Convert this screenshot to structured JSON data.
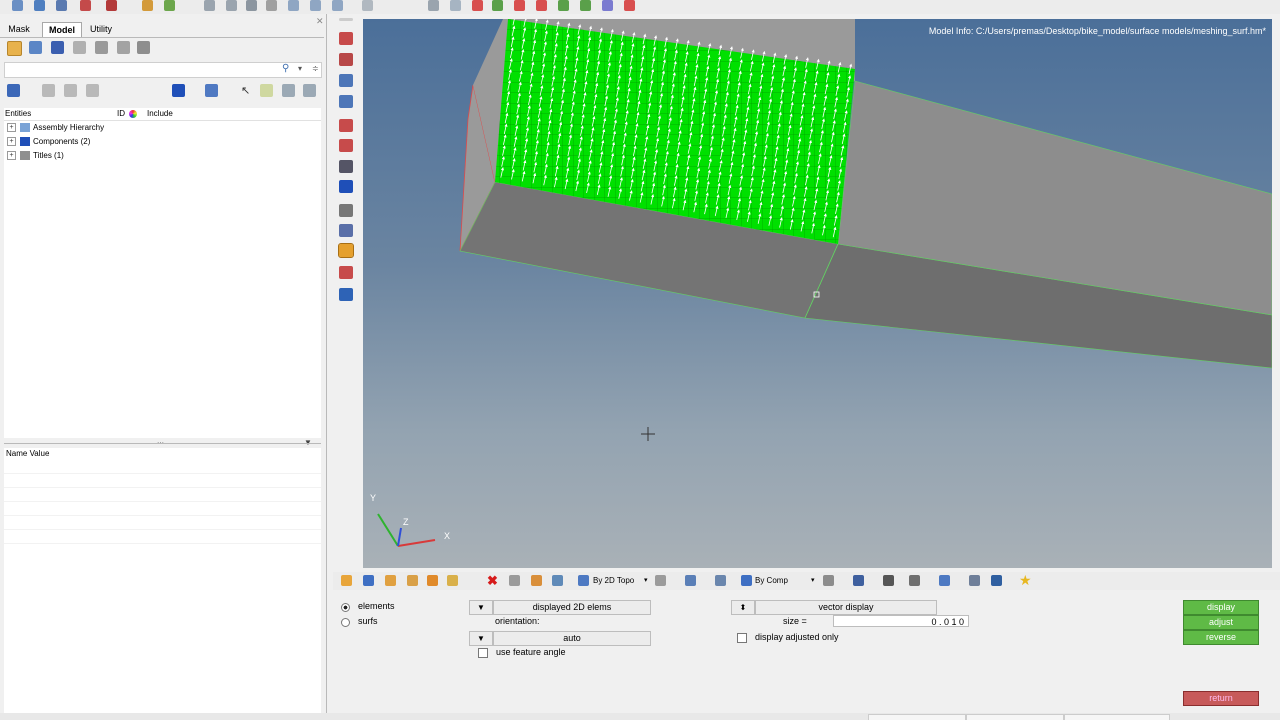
{
  "left_panel": {
    "tabs": [
      {
        "label": "Mask"
      },
      {
        "label": "Model"
      },
      {
        "label": "Utility"
      }
    ],
    "active_tab": "Model",
    "columns": {
      "entities": "Entities",
      "id": "ID",
      "include": "Include"
    },
    "tree": [
      {
        "label": "Assembly Hierarchy",
        "icon": "assembly-icon"
      },
      {
        "label": "Components (2)",
        "icon": "components-icon"
      },
      {
        "label": "Titles (1)",
        "icon": "titles-icon"
      }
    ],
    "name_value_header": "Name Value"
  },
  "viewport": {
    "model_info": "Model Info: C:/Users/premas/Desktop/bike_model/surface models/meshing_surf.hm*",
    "axes": {
      "x": "X",
      "y": "Y",
      "z": "Z"
    }
  },
  "vis_toolbar": {
    "topo_mode": "By 2D Topo",
    "color_mode": "By Comp"
  },
  "panel": {
    "radio_elements": "elements",
    "radio_surfs": "surfs",
    "selector_button": "displayed 2D elems",
    "orientation_label": "orientation:",
    "orientation_value": "auto",
    "use_feature_angle": "use feature angle",
    "vector_display": "vector display",
    "size_label": "size =",
    "size_value": "0 . 0 1 0",
    "display_adjusted_only": "display adjusted only",
    "actions": {
      "display": "display",
      "adjust": "adjust",
      "reverse": "reverse",
      "return": "return"
    }
  },
  "colors": {
    "mesh": "#00e000",
    "action_green": "#5fba46",
    "return_red": "#c75a5a"
  }
}
